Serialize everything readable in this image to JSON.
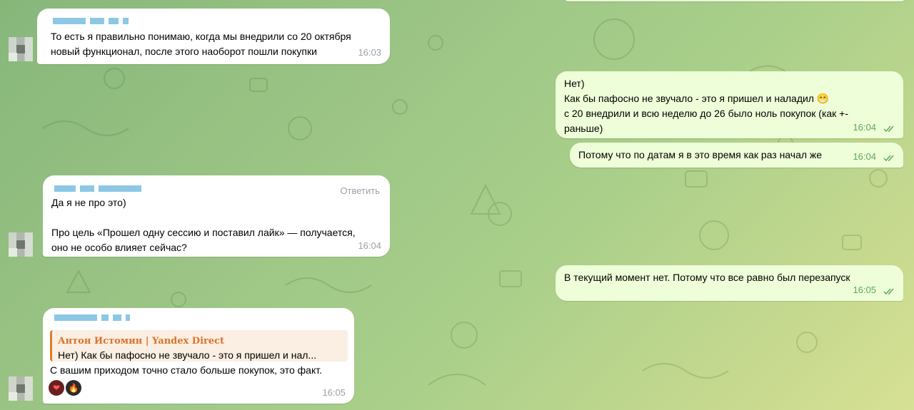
{
  "messages": [
    {
      "text_line1": "То есть я правильно понимаю, когда мы внедрили со 20 октября",
      "text_line2": "новый функционал, после этого наоборот пошли покупки",
      "time": "16:03"
    },
    {
      "text_line1": "Нет)",
      "text_line2": "Как бы пафосно не звучало - это я пришел и наладил 😁",
      "text_line3": "с 20 внедрили и всю неделю до 26 было ноль покупок (как +-",
      "text_line4": "раньше)",
      "time": "16:04"
    },
    {
      "text": "Потому что по датам я в это время как раз начал же",
      "time": "16:04"
    },
    {
      "reply_label": "Ответить",
      "text_line1": "Да я не про это)",
      "text_line2": "Про цель «Прошел одну сессию и поставил лайк» — получается,",
      "text_line3": "оно не особо влияет сейчас?",
      "time": "16:04"
    },
    {
      "text": "В текущий момент нет. Потому что все равно был перезапуск",
      "time": "16:05"
    },
    {
      "quote_name": "Антон Истомин | Yandex Direct",
      "quote_text": "Нет) Как бы пафосно не звучало - это я пришел и нал...",
      "text": "С вашим приходом точно стало больше покупок, это факт.",
      "reactions": [
        "❤",
        "🔥"
      ],
      "time": "16:05"
    }
  ]
}
